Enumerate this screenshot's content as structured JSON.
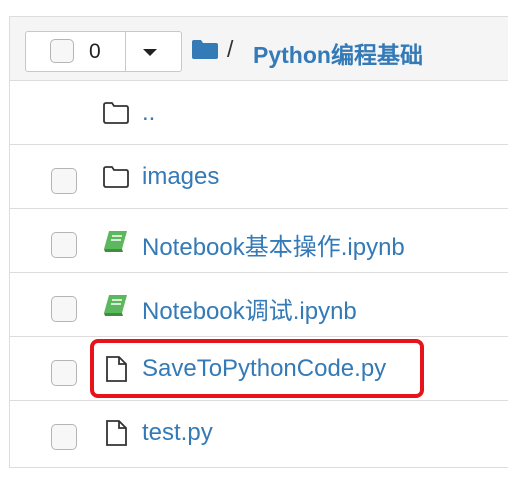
{
  "header": {
    "selected_count": "0",
    "separator": "/",
    "folder_title": "Python编程基础"
  },
  "files": [
    {
      "name": "..",
      "icon": "folder-icon",
      "type": "parent"
    },
    {
      "name": "images",
      "icon": "folder-icon",
      "type": "folder"
    },
    {
      "name": "Notebook基本操作.ipynb",
      "icon": "notebook-icon",
      "type": "notebook"
    },
    {
      "name": "Notebook调试.ipynb",
      "icon": "notebook-icon",
      "type": "notebook"
    },
    {
      "name": "SaveToPythonCode.py",
      "icon": "file-icon",
      "type": "file"
    },
    {
      "name": "test.py",
      "icon": "file-icon",
      "type": "file"
    }
  ],
  "colors": {
    "link": "#337ab7",
    "notebook_icon": "#5cb85c",
    "highlight": "#e8121b"
  }
}
